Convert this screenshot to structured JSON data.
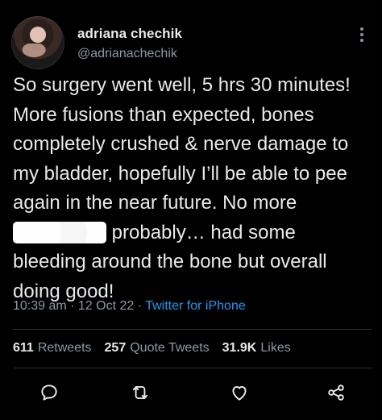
{
  "profile": {
    "display_name": "adriana chechik",
    "handle": "@adrianachechik",
    "avatar_icon": "user-avatar-photo"
  },
  "tweet": {
    "text_part1": "So surgery went well, 5 hrs 30 minutes! More fusions than expected, bones completely crushed & nerve damage to my bladder, hopefully I’ll be able to pee again in the near future. No more ",
    "text_part2": " probably… had some bleeding around the bone but overall doing good!",
    "timestamp": "10:39 am · 12 Oct 22 · ",
    "source": "Twitter for iPhone"
  },
  "stats": {
    "retweets_count": "611",
    "retweets_label": "Retweets",
    "quote_count": "257",
    "quote_label": "Quote Tweets",
    "likes_count": "31.9K",
    "likes_label": "Likes"
  },
  "icons": {
    "more": "more-vertical-icon",
    "reply": "reply-bubble-icon",
    "retweet": "retweet-icon",
    "like": "heart-icon",
    "share": "share-icon"
  },
  "colors": {
    "background": "#000000",
    "text_primary": "#e7e9ea",
    "text_secondary": "#8b98a5",
    "link": "#1d9bf0",
    "divider": "#2f3336"
  }
}
